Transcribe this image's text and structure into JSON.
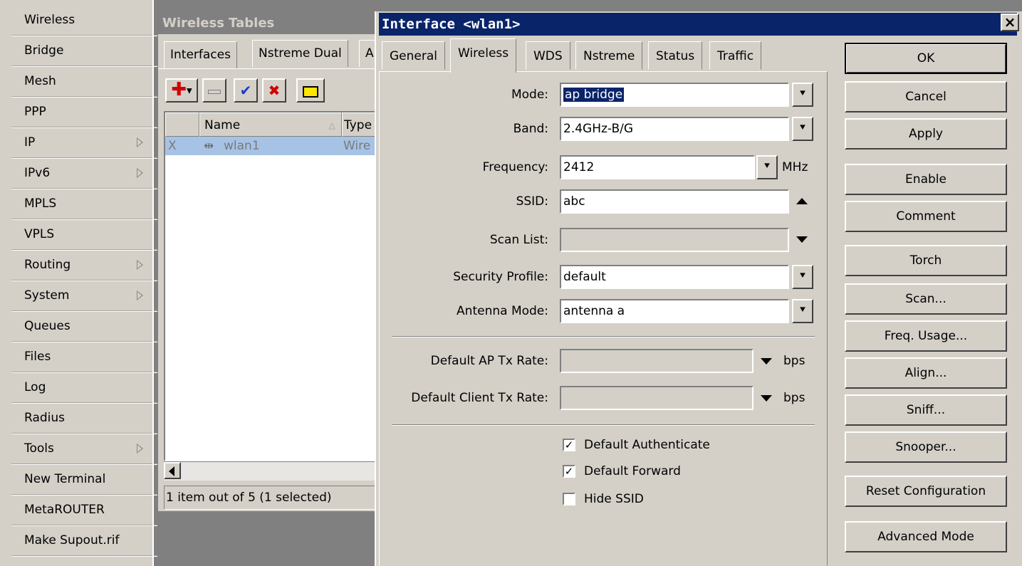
{
  "sidebar": {
    "items": [
      {
        "label": "Wireless",
        "submenu": false
      },
      {
        "label": "Bridge",
        "submenu": false
      },
      {
        "label": "Mesh",
        "submenu": false
      },
      {
        "label": "PPP",
        "submenu": false
      },
      {
        "label": "IP",
        "submenu": true
      },
      {
        "label": "IPv6",
        "submenu": true
      },
      {
        "label": "MPLS",
        "submenu": false
      },
      {
        "label": "VPLS",
        "submenu": false
      },
      {
        "label": "Routing",
        "submenu": true
      },
      {
        "label": "System",
        "submenu": true
      },
      {
        "label": "Queues",
        "submenu": false
      },
      {
        "label": "Files",
        "submenu": false
      },
      {
        "label": "Log",
        "submenu": false
      },
      {
        "label": "Radius",
        "submenu": false
      },
      {
        "label": "Tools",
        "submenu": true
      },
      {
        "label": "New Terminal",
        "submenu": false
      },
      {
        "label": "MetaROUTER",
        "submenu": false
      },
      {
        "label": "Make Supout.rif",
        "submenu": false
      }
    ]
  },
  "wireless_tables": {
    "title": "Wireless Tables",
    "tabs": [
      "Interfaces",
      "Nstreme Dual",
      "A"
    ],
    "toolbar": {
      "add": "add-icon",
      "remove": "remove-icon",
      "enable": "check-icon",
      "disable": "x-icon",
      "comment": "comment-icon"
    },
    "columns": [
      "",
      "Name",
      "Type"
    ],
    "rows": [
      {
        "flag": "X",
        "name": "wlan1",
        "type": "Wire"
      }
    ],
    "status": "1 item out of 5 (1 selected)"
  },
  "dialog": {
    "title": "Interface <wlan1>",
    "close_label": "×",
    "tabs": [
      "General",
      "Wireless",
      "WDS",
      "Nstreme",
      "Status",
      "Traffic"
    ],
    "active_tab": "Wireless",
    "fields": {
      "mode": {
        "label": "Mode:",
        "value": "ap bridge"
      },
      "band": {
        "label": "Band:",
        "value": "2.4GHz-B/G"
      },
      "frequency": {
        "label": "Frequency:",
        "value": "2412",
        "unit": "MHz"
      },
      "ssid": {
        "label": "SSID:",
        "value": "abc"
      },
      "scan_list": {
        "label": "Scan List:",
        "value": ""
      },
      "security_profile": {
        "label": "Security Profile:",
        "value": "default"
      },
      "antenna_mode": {
        "label": "Antenna Mode:",
        "value": "antenna a"
      },
      "default_ap_tx_rate": {
        "label": "Default AP Tx Rate:",
        "value": "",
        "unit": "bps"
      },
      "default_client_tx_rate": {
        "label": "Default Client Tx Rate:",
        "value": "",
        "unit": "bps"
      }
    },
    "checkboxes": [
      {
        "label": "Default Authenticate",
        "checked": true
      },
      {
        "label": "Default Forward",
        "checked": true
      },
      {
        "label": "Hide SSID",
        "checked": false
      }
    ],
    "buttons": [
      "OK",
      "Cancel",
      "Apply",
      "Enable",
      "Comment",
      "Torch",
      "Scan...",
      "Freq. Usage...",
      "Align...",
      "Sniff...",
      "Snooper...",
      "Reset Configuration",
      "Advanced Mode"
    ]
  }
}
